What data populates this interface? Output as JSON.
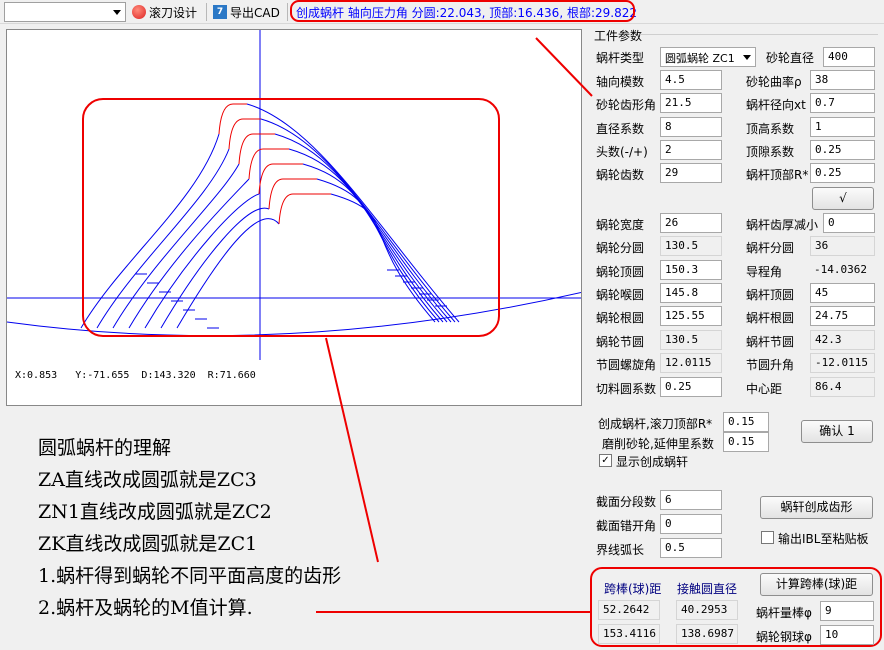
{
  "toolbar": {
    "combo_value": "",
    "hob_design_label": "滚刀设计",
    "export_cad_label": "导出CAD",
    "cad_icon_text": "7",
    "status_text": "创成蜗杆 轴向压力角 分圆:22.043,  顶部:16.436,  根部:29.822"
  },
  "canvas": {
    "coord_readout": "X:0.853   Y:-71.655  D:143.320  R:71.660"
  },
  "annotations": [
    "圆弧蜗杆的理解",
    "ZA直线改成圆弧就是ZC3",
    "ZN1直线改成圆弧就是ZC2",
    "ZK直线改成圆弧就是ZC1",
    "1.蜗杆得到蜗轮不同平面高度的齿形",
    "2.蜗杆及蜗轮的M值计算."
  ],
  "panel": {
    "group_title": "工件参数",
    "worm_type_label": "蜗杆类型",
    "worm_type_value": "圆弧蜗轮 ZC1",
    "wheel_dia_label": "砂轮直径",
    "wheel_dia_value": "400",
    "axial_module_label": "轴向模数",
    "axial_module_value": "4.5",
    "wheel_curv_label": "砂轮曲率ρ",
    "wheel_curv_value": "38",
    "profile_angle_label": "砂轮齿形角",
    "profile_angle_value": "21.5",
    "radial_coef_label": "蜗杆径向xt",
    "radial_coef_value": "0.7",
    "dia_coef_label": "直径系数",
    "dia_coef_value": "8",
    "addendum_coef_label": "顶高系数",
    "addendum_coef_value": "1",
    "starts_label": "头数(-/+)",
    "starts_value": "2",
    "clearance_coef_label": "顶隙系数",
    "clearance_coef_value": "0.25",
    "teeth_label": "蜗轮齿数",
    "teeth_value": "29",
    "tip_r_label": "蜗杆顶部R*",
    "tip_r_value": "0.25",
    "check_button": "√",
    "wheel_width_label": "蜗轮宽度",
    "wheel_width_value": "26",
    "thickness_red_label": "蜗杆齿厚减小",
    "thickness_red_value": "0",
    "wheel_pitch_label": "蜗轮分圆",
    "wheel_pitch_value": "130.5",
    "worm_pitch_label": "蜗杆分圆",
    "worm_pitch_value": "36",
    "wheel_tip_label": "蜗轮顶圆",
    "wheel_tip_value": "150.3",
    "lead_angle_label": "导程角",
    "lead_angle_value": "-14.0362",
    "wheel_throat_label": "蜗轮喉圆",
    "wheel_throat_value": "145.8",
    "worm_tip_label": "蜗杆顶圆",
    "worm_tip_value": "45",
    "wheel_root_label": "蜗轮根圆",
    "wheel_root_value": "125.55",
    "worm_root_label": "蜗杆根圆",
    "worm_root_value": "24.75",
    "wheel_node_label": "蜗轮节圆",
    "wheel_node_value": "130.5",
    "worm_node_label": "蜗杆节圆",
    "worm_node_value": "42.3",
    "helix_label": "节圆螺旋角",
    "helix_value": "12.0115",
    "lift_label": "节圆升角",
    "lift_value": "-12.0115",
    "cut_coef_label": "切料圆系数",
    "cut_coef_value": "0.25",
    "center_dist_label": "中心距",
    "center_dist_value": "86.4",
    "gen_tip_label": "创成蜗杆,滚刀顶部R*",
    "gen_tip_value": "0.15",
    "grind_ext_label": "磨削砂轮,延伸里系数",
    "grind_ext_value": "0.15",
    "confirm_button": "确认 1",
    "show_gen_label": "显示创成蜗轩",
    "section_count_label": "截面分段数",
    "section_count_value": "6",
    "section_offset_label": "截面错开角",
    "section_offset_value": "0",
    "boundary_label": "界线弧长",
    "boundary_value": "0.5",
    "worm_profile_button": "蜗轩创成齿形",
    "output_ibl_label": "输出IBL至粘贴板",
    "span_dist_label": "跨棒(球)距",
    "contact_dia_label": "接触圆直径",
    "calc_button": "计算跨棒(球)距",
    "span1": "52.2642",
    "contact1": "40.2953",
    "span2": "153.4116",
    "contact2": "138.6987",
    "worm_rod_label": "蜗杆量棒φ",
    "worm_rod_value": "9",
    "wheel_ball_label": "蜗轮钢球φ",
    "wheel_ball_value": "10"
  },
  "colors": {
    "profile_blue": "#0000ee",
    "profile_red": "#ee0000",
    "annotation_red": "#e00000",
    "status_blue": "#0000ff"
  }
}
